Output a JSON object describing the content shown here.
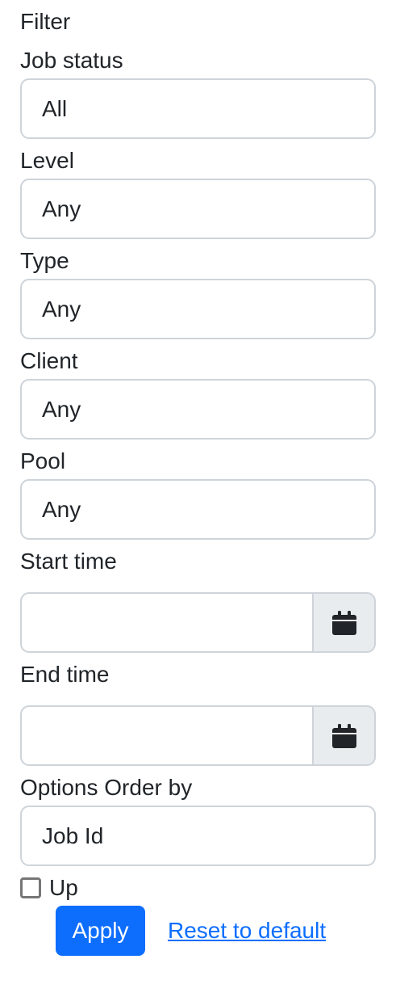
{
  "filter": {
    "heading": "Filter",
    "job_status": {
      "label": "Job status",
      "value": "All"
    },
    "level": {
      "label": "Level",
      "value": "Any"
    },
    "type": {
      "label": "Type",
      "value": "Any"
    },
    "client": {
      "label": "Client",
      "value": "Any"
    },
    "pool": {
      "label": "Pool",
      "value": "Any"
    },
    "start_time": {
      "label": "Start time",
      "value": "",
      "icon": "calendar-icon"
    },
    "end_time": {
      "label": "End time",
      "value": "",
      "icon": "calendar-icon"
    }
  },
  "options": {
    "label": "Options Order by",
    "order_by": {
      "value": "Job Id"
    },
    "up": {
      "label": "Up",
      "checked": false
    }
  },
  "actions": {
    "apply_label": "Apply",
    "reset_label": "Reset to default"
  },
  "colors": {
    "primary": "#0d6efd",
    "border": "#ced4da",
    "addon_bg": "#e9ecef",
    "text": "#212529"
  }
}
